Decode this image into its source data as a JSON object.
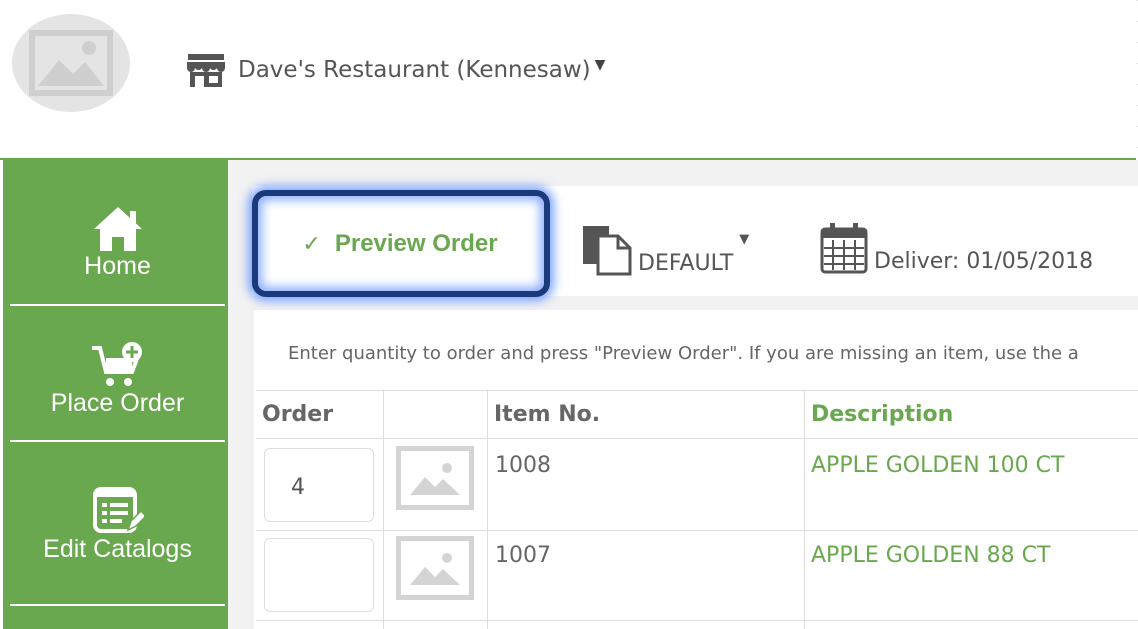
{
  "header": {
    "restaurant_name": "Dave's Restaurant (Kennesaw)"
  },
  "sidebar": {
    "items": [
      {
        "label": "Home",
        "icon": "home-icon"
      },
      {
        "label": "Place Order",
        "icon": "cart-add-icon"
      },
      {
        "label": "Edit Catalogs",
        "icon": "edit-catalog-icon"
      }
    ]
  },
  "toolbar": {
    "preview_label": "Preview Order",
    "catalog_value": "DEFAULT",
    "deliver_text": "Deliver: 01/05/2018"
  },
  "instructions": "Enter quantity to order and press \"Preview Order\". If you are missing an item, use the a",
  "table": {
    "headers": {
      "order": "Order",
      "image": "",
      "item_no": "Item No.",
      "description": "Description"
    },
    "rows": [
      {
        "qty": "4",
        "item_no": "1008",
        "description": "APPLE GOLDEN 100 CT"
      },
      {
        "qty": "",
        "item_no": "1007",
        "description": "APPLE GOLDEN 88 CT"
      }
    ]
  },
  "colors": {
    "accent": "#6aa84f",
    "highlight_border": "#1b3a7a"
  }
}
